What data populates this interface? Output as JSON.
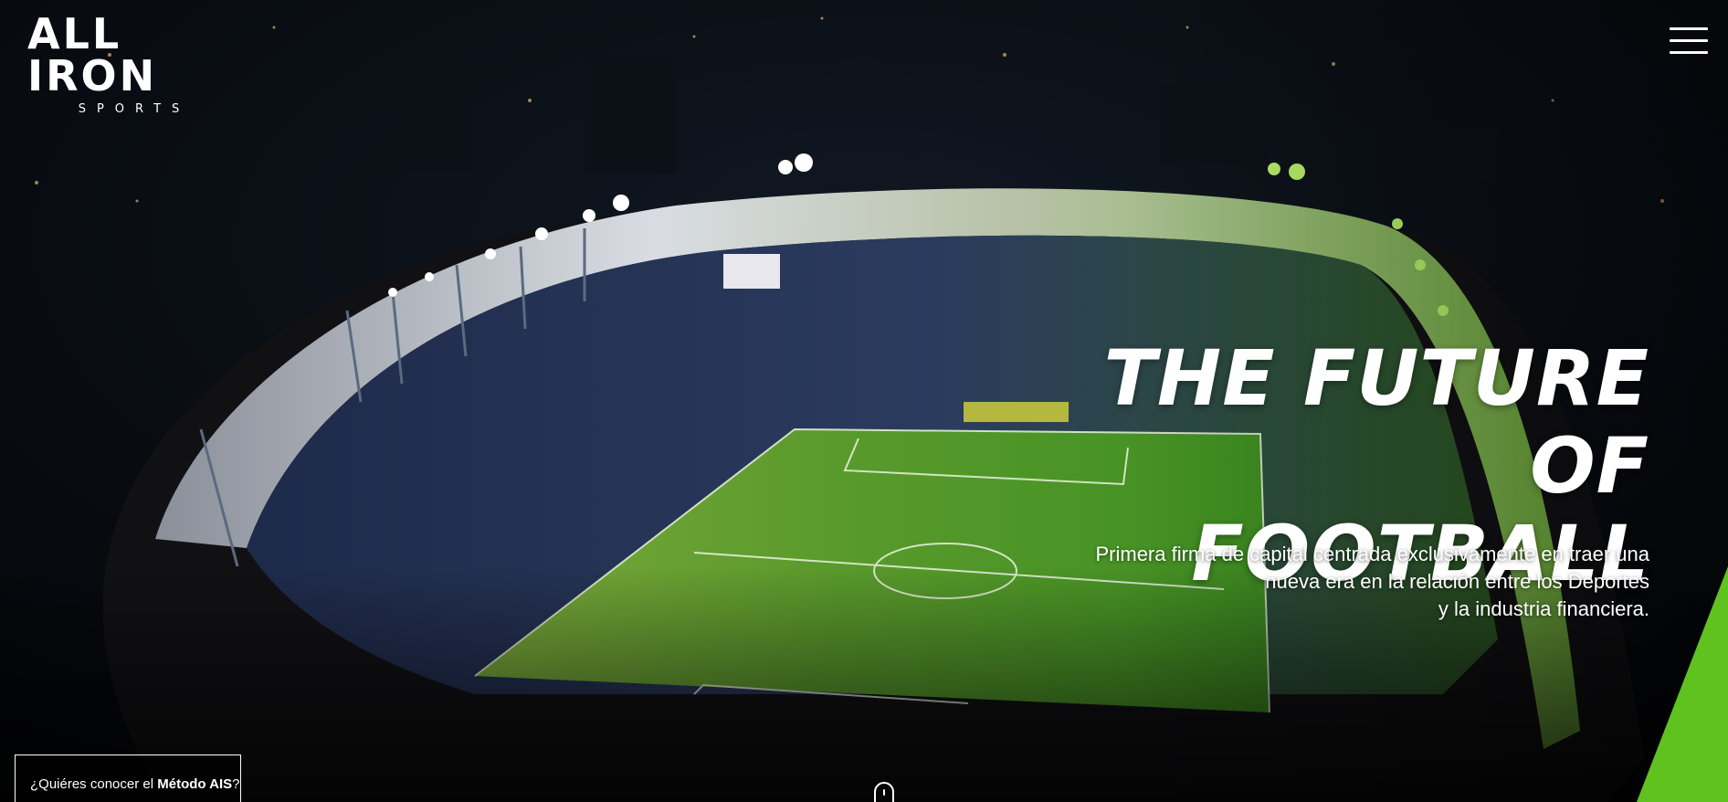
{
  "header": {
    "logo_main": "ALL IRON",
    "logo_sub": "SPORTS",
    "menu_icon": "hamburger-menu-icon"
  },
  "hero": {
    "headline_line1": "THE FUTURE",
    "headline_line2": "OF FOOTBALL",
    "subtext_line1": "Primera firma de capital centrada exclusivamente en traer una",
    "subtext_line2": "nueva era en la relación entre los Deportes",
    "subtext_line3": "y la industria financiera.",
    "background": "aerial-night-stadium-image"
  },
  "cta": {
    "prefix": "¿Quiéres conocer el ",
    "bold": "Método AIS",
    "suffix": "?"
  },
  "scroll": {
    "icon": "scroll-mouse-icon"
  },
  "colors": {
    "accent": "#5fc21e",
    "background": "#05070a",
    "pitch_green": "#3f8f22",
    "text": "#ffffff"
  }
}
